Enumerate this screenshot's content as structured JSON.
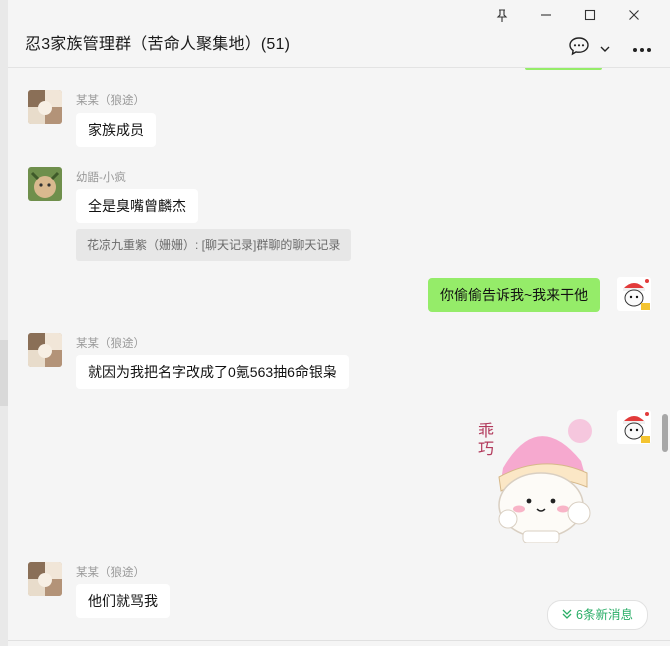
{
  "window": {
    "title": "忍3家族管理群（苦命人聚集地）(51)",
    "controls": [
      "pin-icon",
      "minimize-icon",
      "maximize-icon",
      "close-icon"
    ]
  },
  "header_icons": [
    "chat-bubble-icon",
    "chevron-down-icon",
    "more-icon"
  ],
  "messages": [
    {
      "sender": "某某（狼途）",
      "text": "家族成员",
      "avatar": "mosaic-avatar"
    },
    {
      "sender": "幼鼯-小疯",
      "text": "全是臭嘴曾麟杰",
      "quote": "花凉九重紫（姗姗）: [聊天记录]群聊的聊天记录",
      "avatar": "cat-avatar"
    },
    {
      "text": "你偷偷告诉我~我来干他",
      "self": true,
      "avatar": "santa-avatar"
    },
    {
      "sender": "某某（狼途）",
      "text": "就因为我把名字改成了0氪563抽6命银枭",
      "avatar": "mosaic-avatar"
    },
    {
      "sticker_text": "乖巧",
      "self": true,
      "avatar": "santa-avatar"
    },
    {
      "sender": "某某（狼途）",
      "text": "他们就骂我",
      "avatar": "mosaic-avatar"
    }
  ],
  "new_messages": {
    "label": "6条新消息",
    "icon": "double-chevron-down-icon"
  },
  "colors": {
    "green_bubble": "#95ec69",
    "accent": "#2aae67",
    "background": "#f5f5f5"
  }
}
